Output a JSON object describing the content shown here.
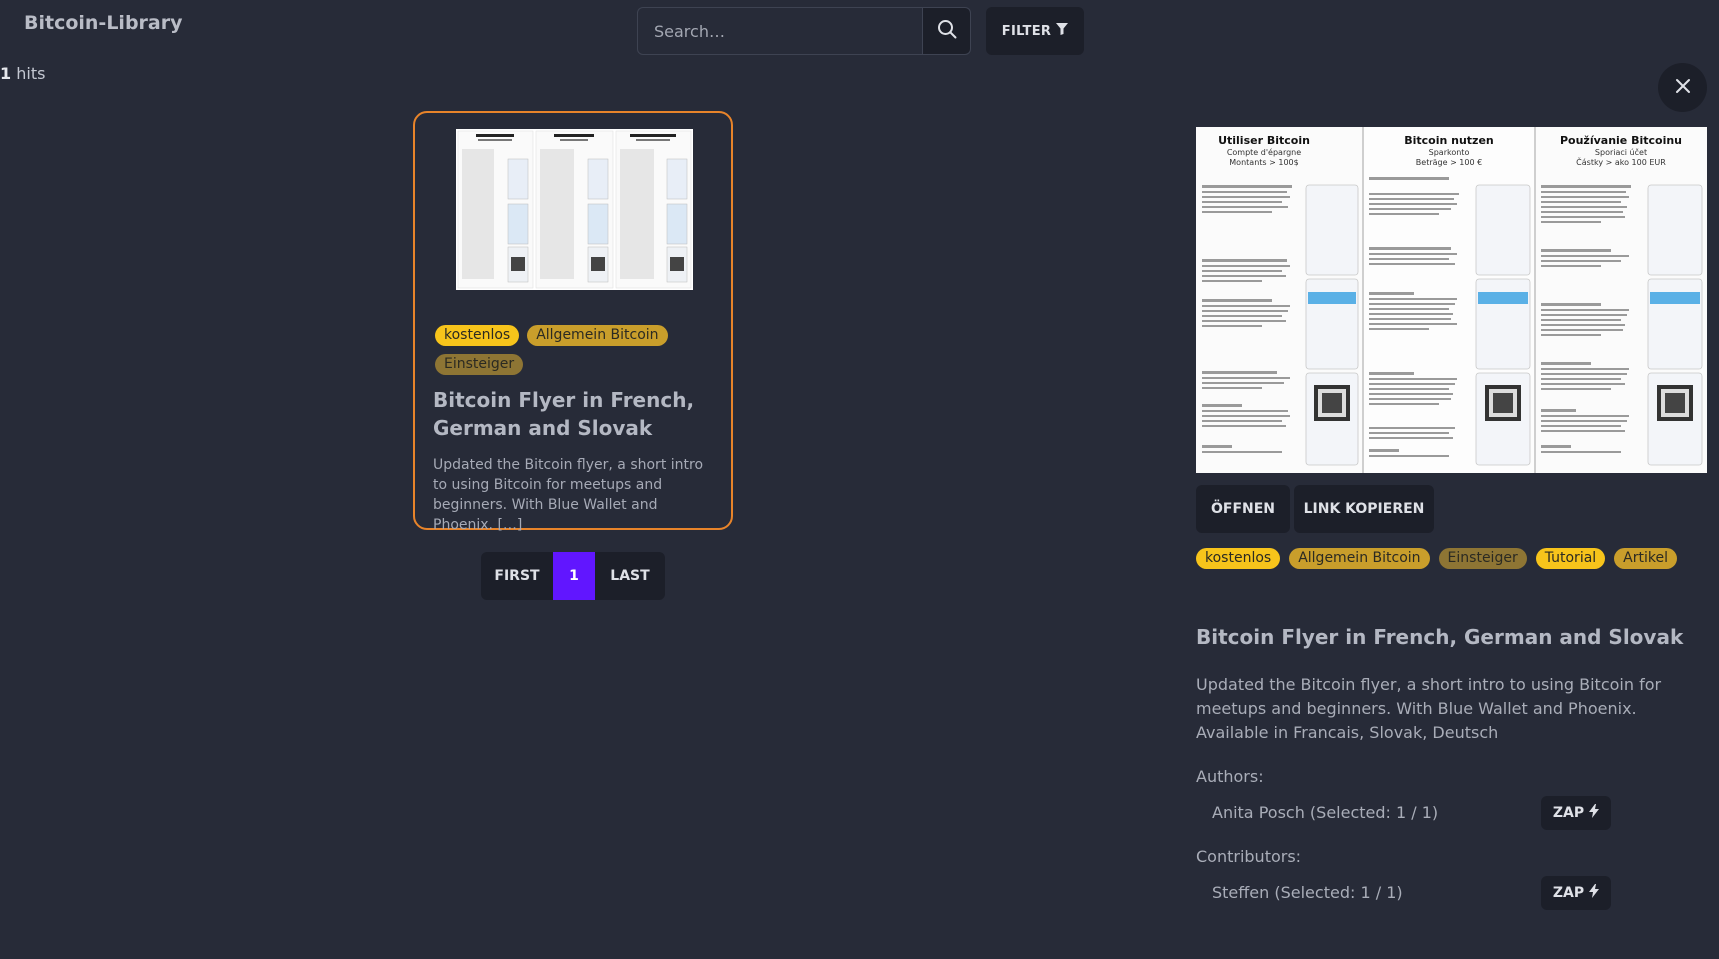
{
  "header": {
    "logo": "Bitcoin-Library",
    "search_placeholder": "Search…",
    "filter_label": "FILTER"
  },
  "results": {
    "count": "1",
    "count_suffix": " hits"
  },
  "card": {
    "tags": [
      "kostenlos",
      "Allgemein Bitcoin",
      "Einsteiger"
    ],
    "title": "Bitcoin Flyer in French, German and Slovak",
    "description": "Updated the Bitcoin flyer, a short intro to using Bitcoin for meetups and beginners. With Blue Wallet and Phoenix. […]"
  },
  "pagination": {
    "first": "FIRST",
    "current": "1",
    "last": "LAST"
  },
  "preview": {
    "panels": [
      {
        "title": "Utiliser Bitcoin",
        "sub1": "Compte d'épargne",
        "sub2": "Montants > 100$"
      },
      {
        "title": "Bitcoin nutzen",
        "sub1": "Sparkonto",
        "sub2": "Beträge > 100 €"
      },
      {
        "title": "Používanie Bitcoinu",
        "sub1": "Sporiaci účet",
        "sub2": "Částky > ako 100 EUR"
      }
    ]
  },
  "detail": {
    "open_label": "ÖFFNEN",
    "copy_label": "LINK KOPIEREN",
    "tags": [
      "kostenlos",
      "Allgemein Bitcoin",
      "Einsteiger",
      "Tutorial",
      "Artikel"
    ],
    "title": "Bitcoin Flyer in French, German and Slovak",
    "description": "Updated the Bitcoin flyer, a short intro to using Bitcoin for meetups and beginners. With Blue Wallet and Phoenix. Available in Francais, Slovak, Deutsch",
    "authors_label": "Authors:",
    "author": "Anita Posch (Selected: 1 / 1)",
    "contributors_label": "Contributors:",
    "contributor": "Steffen (Selected: 1 / 1)",
    "zap_label": "ZAP"
  },
  "colors": {
    "background": "#272b38",
    "card_border": "#e8842a",
    "active_page": "#6116ff",
    "tag_kostenlos": "#f7c41b",
    "tag_allgemein": "#c99e2b",
    "tag_einsteiger": "#8e7534"
  },
  "icons": {
    "search": "search-icon",
    "filter": "filter-icon",
    "close": "close-icon",
    "zap": "lightning-icon"
  }
}
